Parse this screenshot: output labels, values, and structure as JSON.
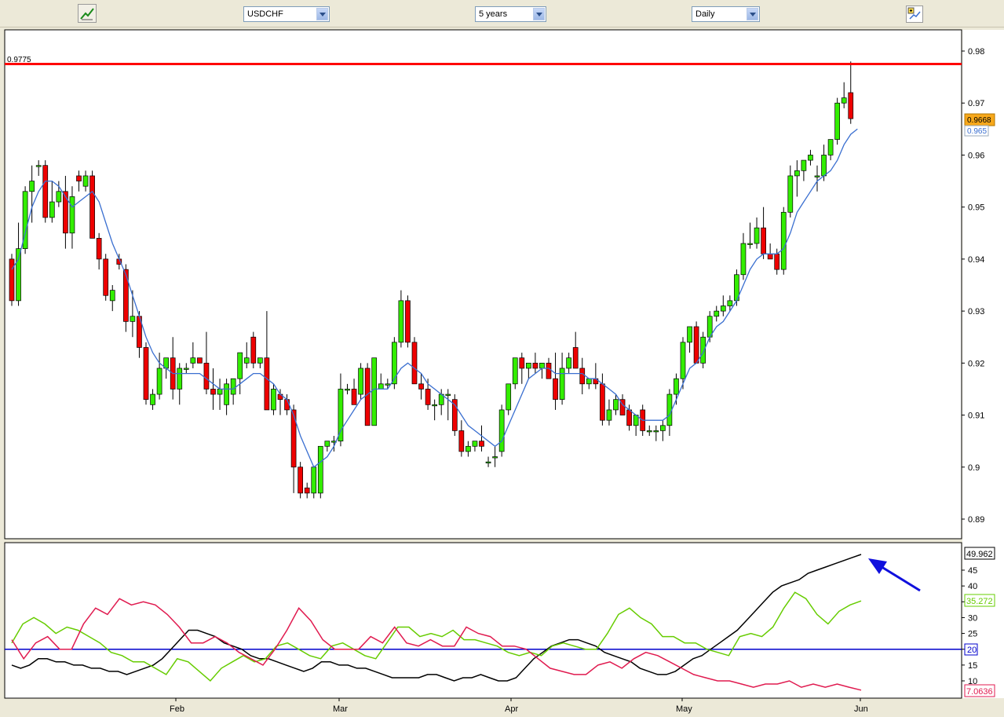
{
  "toolbar": {
    "left_icon": "chart-tool-icon",
    "symbol": "USDCHF",
    "range": "5 years",
    "period": "Daily",
    "right_icon": "chart-settings-icon"
  },
  "price_panel": {
    "resistance_label": "0.9775",
    "last_price_label": "0.9668",
    "ma_label": "0.965",
    "y_ticks": [
      "0.98",
      "0.97",
      "0.96",
      "0.95",
      "0.94",
      "0.93",
      "0.92",
      "0.91",
      "0.9",
      "0.89"
    ],
    "colors": {
      "up": "#33ee00",
      "down": "#ee0000",
      "ma": "#3a6fd0",
      "resistance": "#ff0000"
    }
  },
  "indicator_panel": {
    "y_ticks": [
      "45",
      "40",
      "35",
      "30",
      "25",
      "20",
      "15",
      "10"
    ],
    "adx_label": "49.962",
    "plus_di_label": "35.272",
    "level_label": "20",
    "minus_di_label": "7.0636",
    "colors": {
      "adx": "#000000",
      "plus_di": "#66cc00",
      "minus_di": "#e01a4f",
      "level": "#0000cc",
      "arrow": "#1010dd"
    }
  },
  "x_axis": {
    "labels": [
      "Feb",
      "Mar",
      "Apr",
      "May",
      "Jun"
    ]
  },
  "chart_data": [
    {
      "type": "candlestick",
      "ylim": [
        0.887,
        0.985
      ],
      "resistance": 0.9775,
      "candles": [
        [
          0.94,
          0.941,
          0.931,
          0.932
        ],
        [
          0.932,
          0.947,
          0.931,
          0.942
        ],
        [
          0.942,
          0.954,
          0.941,
          0.953
        ],
        [
          0.953,
          0.958,
          0.947,
          0.955
        ],
        [
          0.958,
          0.959,
          0.956,
          0.958
        ],
        [
          0.958,
          0.959,
          0.947,
          0.948
        ],
        [
          0.948,
          0.955,
          0.947,
          0.951
        ],
        [
          0.951,
          0.955,
          0.95,
          0.953
        ],
        [
          0.953,
          0.956,
          0.942,
          0.945
        ],
        [
          0.945,
          0.954,
          0.942,
          0.952
        ],
        [
          0.956,
          0.957,
          0.953,
          0.955
        ],
        [
          0.954,
          0.957,
          0.953,
          0.956
        ],
        [
          0.956,
          0.957,
          0.946,
          0.944
        ],
        [
          0.944,
          0.945,
          0.938,
          0.94
        ],
        [
          0.94,
          0.941,
          0.932,
          0.933
        ],
        [
          0.932,
          0.935,
          0.93,
          0.934
        ],
        [
          0.94,
          0.941,
          0.938,
          0.939
        ],
        [
          0.938,
          0.939,
          0.926,
          0.928
        ],
        [
          0.928,
          0.934,
          0.925,
          0.929
        ],
        [
          0.929,
          0.93,
          0.921,
          0.923
        ],
        [
          0.923,
          0.924,
          0.912,
          0.913
        ],
        [
          0.912,
          0.915,
          0.911,
          0.914
        ],
        [
          0.914,
          0.922,
          0.913,
          0.919
        ],
        [
          0.919,
          0.92,
          0.917,
          0.921
        ],
        [
          0.921,
          0.925,
          0.913,
          0.915
        ],
        [
          0.915,
          0.92,
          0.912,
          0.919
        ],
        [
          0.919,
          0.92,
          0.918,
          0.919
        ],
        [
          0.92,
          0.924,
          0.919,
          0.921
        ],
        [
          0.921,
          0.921,
          0.92,
          0.92
        ],
        [
          0.92,
          0.926,
          0.914,
          0.915
        ],
        [
          0.915,
          0.919,
          0.911,
          0.914
        ],
        [
          0.914,
          0.917,
          0.911,
          0.915
        ],
        [
          0.912,
          0.917,
          0.91,
          0.916
        ],
        [
          0.914,
          0.916,
          0.912,
          0.917
        ],
        [
          0.917,
          0.922,
          0.914,
          0.922
        ],
        [
          0.92,
          0.924,
          0.919,
          0.921
        ],
        [
          0.925,
          0.926,
          0.919,
          0.92
        ],
        [
          0.92,
          0.921,
          0.919,
          0.921
        ],
        [
          0.921,
          0.93,
          0.911,
          0.911
        ],
        [
          0.911,
          0.916,
          0.91,
          0.915
        ],
        [
          0.914,
          0.915,
          0.91,
          0.913
        ],
        [
          0.913,
          0.914,
          0.91,
          0.911
        ],
        [
          0.911,
          0.912,
          0.895,
          0.9
        ],
        [
          0.9,
          0.901,
          0.894,
          0.895
        ],
        [
          0.896,
          0.897,
          0.894,
          0.895
        ],
        [
          0.895,
          0.9,
          0.894,
          0.9
        ],
        [
          0.895,
          0.899,
          0.894,
          0.904
        ],
        [
          0.904,
          0.905,
          0.903,
          0.905
        ],
        [
          0.905,
          0.906,
          0.903,
          0.905
        ],
        [
          0.905,
          0.918,
          0.904,
          0.915
        ],
        [
          0.915,
          0.916,
          0.914,
          0.915
        ],
        [
          0.915,
          0.917,
          0.912,
          0.912
        ],
        [
          0.914,
          0.92,
          0.913,
          0.919
        ],
        [
          0.919,
          0.92,
          0.908,
          0.908
        ],
        [
          0.908,
          0.921,
          0.908,
          0.921
        ],
        [
          0.915,
          0.918,
          0.915,
          0.916
        ],
        [
          0.916,
          0.917,
          0.915,
          0.916
        ],
        [
          0.916,
          0.925,
          0.915,
          0.924
        ],
        [
          0.924,
          0.934,
          0.923,
          0.932
        ],
        [
          0.932,
          0.933,
          0.923,
          0.924
        ],
        [
          0.924,
          0.925,
          0.916,
          0.916
        ],
        [
          0.916,
          0.918,
          0.913,
          0.915
        ],
        [
          0.915,
          0.917,
          0.911,
          0.912
        ],
        [
          0.912,
          0.913,
          0.909,
          0.912
        ],
        [
          0.912,
          0.915,
          0.91,
          0.914
        ],
        [
          0.914,
          0.915,
          0.909,
          0.914
        ],
        [
          0.913,
          0.914,
          0.906,
          0.907
        ],
        [
          0.907,
          0.909,
          0.902,
          0.903
        ],
        [
          0.903,
          0.905,
          0.902,
          0.904
        ],
        [
          0.904,
          0.905,
          0.903,
          0.905
        ],
        [
          0.905,
          0.908,
          0.903,
          0.904
        ],
        [
          0.901,
          0.902,
          0.9,
          0.901
        ],
        [
          0.902,
          0.904,
          0.9,
          0.902
        ],
        [
          0.903,
          0.912,
          0.902,
          0.911
        ],
        [
          0.911,
          0.916,
          0.91,
          0.916
        ],
        [
          0.916,
          0.921,
          0.915,
          0.921
        ],
        [
          0.921,
          0.922,
          0.916,
          0.919
        ],
        [
          0.919,
          0.92,
          0.917,
          0.92
        ],
        [
          0.92,
          0.922,
          0.918,
          0.919
        ],
        [
          0.919,
          0.92,
          0.917,
          0.92
        ],
        [
          0.92,
          0.921,
          0.918,
          0.917
        ],
        [
          0.917,
          0.922,
          0.911,
          0.913
        ],
        [
          0.913,
          0.922,
          0.912,
          0.919
        ],
        [
          0.919,
          0.922,
          0.918,
          0.921
        ],
        [
          0.923,
          0.926,
          0.919,
          0.919
        ],
        [
          0.919,
          0.921,
          0.914,
          0.916
        ],
        [
          0.916,
          0.917,
          0.915,
          0.917
        ],
        [
          0.917,
          0.92,
          0.915,
          0.916
        ],
        [
          0.916,
          0.918,
          0.908,
          0.909
        ],
        [
          0.909,
          0.913,
          0.908,
          0.911
        ],
        [
          0.911,
          0.914,
          0.91,
          0.913
        ],
        [
          0.913,
          0.914,
          0.91,
          0.91
        ],
        [
          0.911,
          0.912,
          0.907,
          0.908
        ],
        [
          0.908,
          0.91,
          0.906,
          0.91
        ],
        [
          0.911,
          0.912,
          0.906,
          0.907
        ],
        [
          0.907,
          0.908,
          0.906,
          0.907
        ],
        [
          0.907,
          0.908,
          0.905,
          0.907
        ],
        [
          0.907,
          0.909,
          0.905,
          0.908
        ],
        [
          0.908,
          0.915,
          0.906,
          0.914
        ],
        [
          0.914,
          0.918,
          0.912,
          0.917
        ],
        [
          0.917,
          0.925,
          0.915,
          0.924
        ],
        [
          0.924,
          0.927,
          0.922,
          0.927
        ],
        [
          0.927,
          0.928,
          0.92,
          0.92
        ],
        [
          0.92,
          0.926,
          0.919,
          0.925
        ],
        [
          0.925,
          0.93,
          0.924,
          0.929
        ],
        [
          0.929,
          0.931,
          0.928,
          0.93
        ],
        [
          0.93,
          0.933,
          0.929,
          0.931
        ],
        [
          0.931,
          0.933,
          0.93,
          0.932
        ],
        [
          0.932,
          0.938,
          0.931,
          0.937
        ],
        [
          0.937,
          0.945,
          0.936,
          0.943
        ],
        [
          0.943,
          0.947,
          0.942,
          0.943
        ],
        [
          0.943,
          0.948,
          0.942,
          0.946
        ],
        [
          0.946,
          0.95,
          0.94,
          0.941
        ],
        [
          0.941,
          0.943,
          0.94,
          0.94
        ],
        [
          0.941,
          0.942,
          0.937,
          0.938
        ],
        [
          0.938,
          0.95,
          0.937,
          0.949
        ],
        [
          0.949,
          0.958,
          0.948,
          0.956
        ],
        [
          0.956,
          0.959,
          0.952,
          0.957
        ],
        [
          0.957,
          0.959,
          0.955,
          0.959
        ],
        [
          0.959,
          0.961,
          0.958,
          0.96
        ],
        [
          0.956,
          0.958,
          0.953,
          0.956
        ],
        [
          0.956,
          0.962,
          0.955,
          0.96
        ],
        [
          0.96,
          0.963,
          0.959,
          0.963
        ],
        [
          0.963,
          0.971,
          0.962,
          0.97
        ],
        [
          0.97,
          0.974,
          0.969,
          0.971
        ],
        [
          0.972,
          0.978,
          0.966,
          0.967
        ]
      ],
      "moving_average": [
        0.938,
        0.94,
        0.945,
        0.95,
        0.953,
        0.955,
        0.955,
        0.954,
        0.952,
        0.95,
        0.951,
        0.952,
        0.953,
        0.951,
        0.947,
        0.943,
        0.94,
        0.937,
        0.933,
        0.929,
        0.925,
        0.922,
        0.92,
        0.919,
        0.918,
        0.918,
        0.918,
        0.918,
        0.918,
        0.917,
        0.916,
        0.915,
        0.915,
        0.915,
        0.916,
        0.917,
        0.918,
        0.918,
        0.917,
        0.916,
        0.914,
        0.913,
        0.91,
        0.906,
        0.903,
        0.9,
        0.901,
        0.902,
        0.904,
        0.907,
        0.909,
        0.911,
        0.913,
        0.914,
        0.915,
        0.915,
        0.915,
        0.917,
        0.919,
        0.92,
        0.919,
        0.918,
        0.916,
        0.915,
        0.914,
        0.913,
        0.912,
        0.91,
        0.908,
        0.907,
        0.906,
        0.905,
        0.904,
        0.905,
        0.908,
        0.911,
        0.914,
        0.917,
        0.918,
        0.919,
        0.919,
        0.918,
        0.918,
        0.918,
        0.918,
        0.918,
        0.917,
        0.917,
        0.916,
        0.915,
        0.914,
        0.912,
        0.911,
        0.91,
        0.909,
        0.909,
        0.909,
        0.909,
        0.91,
        0.913,
        0.916,
        0.919,
        0.92,
        0.922,
        0.925,
        0.927,
        0.928,
        0.93,
        0.932,
        0.935,
        0.938,
        0.94,
        0.941,
        0.941,
        0.941,
        0.942,
        0.945,
        0.949,
        0.951,
        0.953,
        0.955,
        0.956,
        0.957,
        0.959,
        0.962,
        0.964,
        0.965
      ]
    },
    {
      "type": "line",
      "ylim": [
        5,
        52
      ],
      "level": 20,
      "series": [
        {
          "values": [
            15,
            14,
            15,
            17,
            17,
            16,
            16,
            15,
            15,
            14,
            14,
            13,
            13,
            12,
            13,
            14,
            15,
            17,
            20,
            23,
            26,
            26,
            25,
            24,
            22,
            21,
            20,
            18,
            17,
            17,
            16,
            15,
            14,
            13,
            14,
            16,
            16,
            15,
            15,
            14,
            14,
            13,
            12,
            11,
            11,
            11,
            11,
            12,
            12,
            11,
            10,
            11,
            11,
            12,
            11,
            10,
            10,
            11,
            14,
            17,
            19,
            21,
            22,
            23,
            23,
            22,
            21,
            19,
            18,
            17,
            16,
            14,
            13,
            12,
            12,
            13,
            15,
            17,
            18,
            20,
            22,
            24,
            26,
            29,
            32,
            35,
            38,
            40,
            41,
            42,
            44,
            45,
            46,
            47,
            48,
            49,
            49.962
          ]
        },
        {
          "values": [
            22,
            28,
            30,
            28,
            25,
            27,
            26,
            24,
            22,
            19,
            18,
            16,
            16,
            14,
            12,
            17,
            16,
            13,
            10,
            14,
            16,
            18,
            16,
            17,
            21,
            22,
            20,
            18,
            17,
            21,
            22,
            20,
            18,
            17,
            22,
            27,
            27,
            24,
            25,
            24,
            26,
            23,
            23,
            22,
            21,
            19,
            18,
            19,
            18,
            21,
            22,
            21,
            20,
            20,
            25,
            31,
            33,
            30,
            28,
            24,
            24,
            22,
            22,
            20,
            19,
            18,
            24,
            25,
            24,
            27,
            33,
            38,
            36,
            31,
            28,
            32,
            34,
            35.272
          ]
        },
        {
          "values": [
            23,
            17,
            22,
            24,
            20,
            20,
            28,
            33,
            31,
            36,
            34,
            35,
            34,
            31,
            27,
            22,
            22,
            24,
            22,
            19,
            17,
            15,
            20,
            26,
            33,
            29,
            23,
            20,
            20,
            20,
            24,
            22,
            27,
            22,
            21,
            23,
            21,
            21,
            27,
            25,
            24,
            21,
            21,
            20,
            17,
            14,
            13,
            12,
            12,
            15,
            16,
            14,
            17,
            19,
            18,
            16,
            14,
            12,
            11,
            10,
            10,
            9,
            8,
            9,
            9,
            10,
            8,
            9,
            8,
            9,
            8,
            7.0636
          ]
        }
      ]
    }
  ]
}
